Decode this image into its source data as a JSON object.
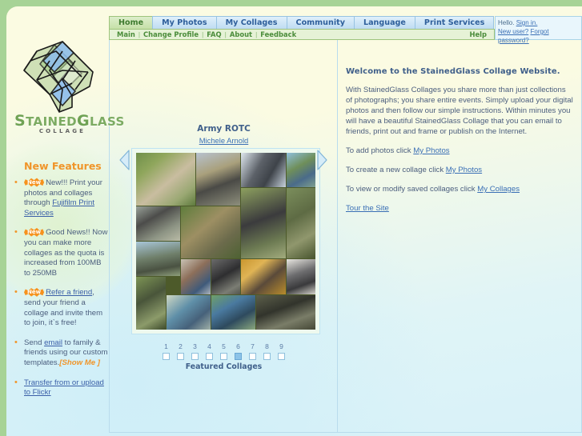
{
  "site": {
    "logo_word_1": "S",
    "logo_word_rest": "TAINED",
    "logo_word_2": "G",
    "logo_word_rest2": "LASS",
    "logo_sub": "COLLAGE"
  },
  "tabs": [
    {
      "label": "Home",
      "active": true
    },
    {
      "label": "My Photos",
      "active": false
    },
    {
      "label": "My Collages",
      "active": false
    },
    {
      "label": "Community",
      "active": false
    },
    {
      "label": "Language",
      "active": false
    },
    {
      "label": "Print Services",
      "active": false
    }
  ],
  "subnav": {
    "items": [
      "Main",
      "Change Profile",
      "FAQ",
      "About",
      "Feedback"
    ],
    "help_label": "Help"
  },
  "login": {
    "hello": "Hello.",
    "sign_in": "Sign in.",
    "new_user": "New user?",
    "forgot": "Forgot password?"
  },
  "sidebar": {
    "title": "New Features",
    "items": [
      {
        "badge": "New",
        "text_before": "New!!! Print your photos and collages through ",
        "link": "Fujifilm Print Services",
        "text_after": ""
      },
      {
        "badge": "New",
        "text_before": "Good News!! Now you can make more collages as the quota is increased from 100MB to 250MB",
        "link": "",
        "text_after": ""
      },
      {
        "badge": "New",
        "text_before": "",
        "link": "Refer a friend",
        "text_after": ", send your friend a collage and invite them to join, it`s free!"
      },
      {
        "badge": "",
        "text_before": "Send ",
        "link": "email",
        "text_after": " to family & friends using our custom templates.",
        "showme": "[Show Me ]"
      },
      {
        "badge": "",
        "text_before": "",
        "link": "Transfer from or upload to Flickr",
        "text_after": ""
      }
    ]
  },
  "collage": {
    "title": "Army ROTC",
    "author": "Michele Arnold",
    "prev_icon": "triangle-left-icon",
    "next_icon": "triangle-right-icon",
    "pages": [
      "1",
      "2",
      "3",
      "4",
      "5",
      "6",
      "7",
      "8",
      "9"
    ],
    "selected_page": 6,
    "featured_label": "Featured Collages"
  },
  "welcome": {
    "heading": "Welcome to the StainedGlass Collage Website.",
    "body": "With StainedGlass Collages you share more than just collections of photographs; you share entire events. Simply upload your digital photos and then follow our simple instructions. Within minutes you will have a beautiful StainedGlass Collage that you can email to friends, print out and frame or publish on the Internet.",
    "cta1_before": "To add photos click ",
    "cta1_link": "My Photos",
    "cta2_before": "To create a new collage click ",
    "cta2_link": "My Photos",
    "cta3_before": "To view or modify saved collages click ",
    "cta3_link": "My Collages",
    "tour_link": "Tour the Site"
  },
  "colors": {
    "page_bg": "#a7d396",
    "card_bg": "#fbfbe2",
    "accent_orange": "#f0952a",
    "link_blue": "#3a6fb5",
    "tab_green": "#c6e0a8",
    "tab_blue": "#bfdcf2"
  }
}
